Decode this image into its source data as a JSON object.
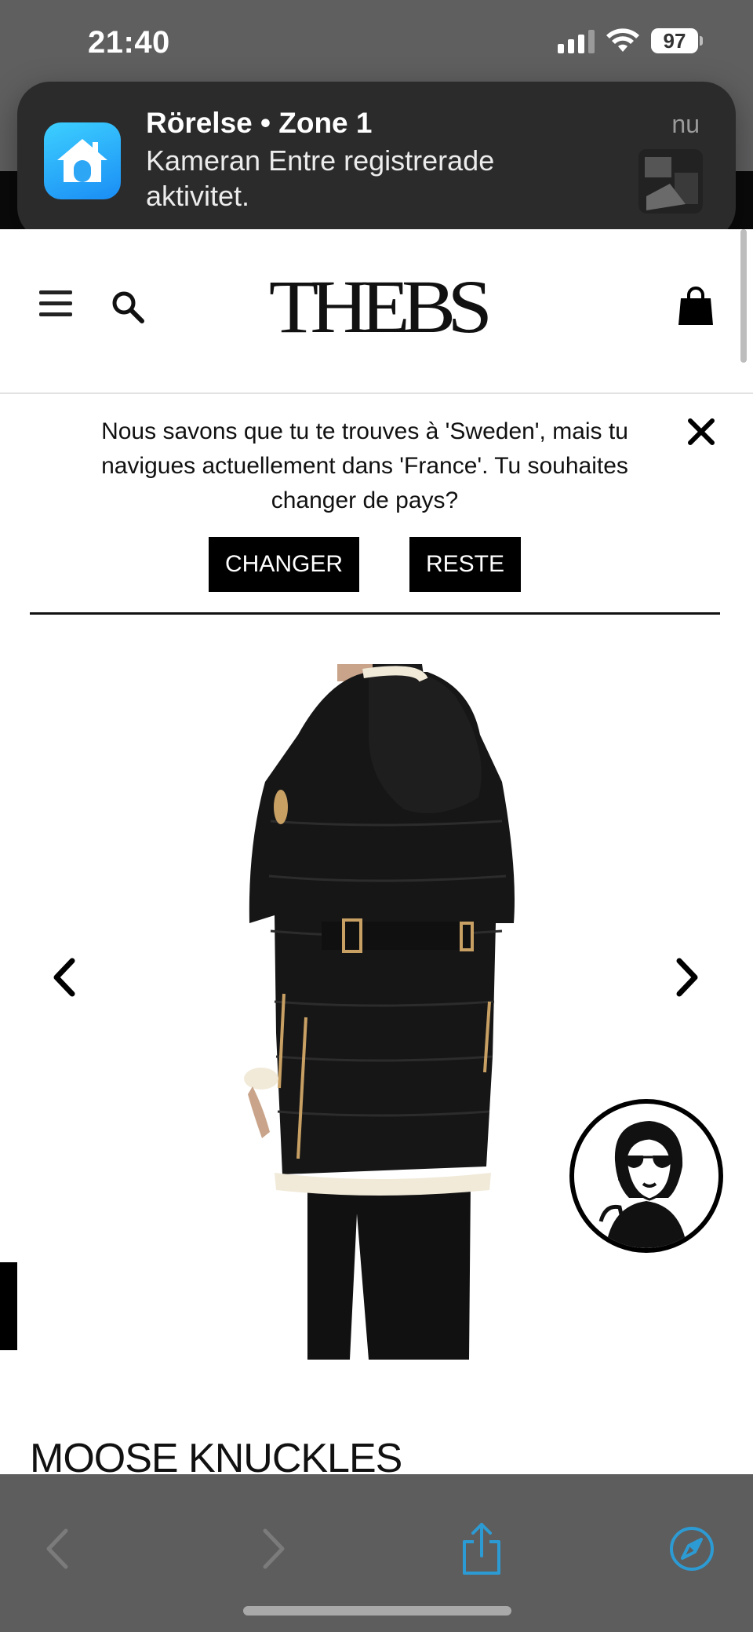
{
  "status_bar": {
    "time": "21:40",
    "battery": "97"
  },
  "notification": {
    "title": "Rörelse • Zone 1",
    "body": "Kameran Entre registrerade aktivitet.",
    "time": "nu",
    "app_icon": "home-app-icon"
  },
  "header": {
    "logo": "THEBS",
    "menu_icon": "hamburger-menu-icon",
    "search_icon": "search-icon",
    "cart_icon": "shopping-bag-icon"
  },
  "country_banner": {
    "message": "Nous savons que tu te trouves à 'Sweden', mais tu navigues actuellement dans 'France'. Tu souhaites changer de pays?",
    "change_label": "CHANGER",
    "stay_label": "RESTE"
  },
  "product": {
    "brand": "MOOSE KNUCKLES",
    "image_icon": "black-parka-photo"
  },
  "browser_toolbar": {
    "back_icon": "chevron-left-icon",
    "forward_icon": "chevron-right-icon",
    "share_icon": "share-icon",
    "safari_icon": "compass-icon"
  },
  "colors": {
    "accent": "#2d9bd3",
    "toolbar": "#5d5d5e",
    "notification": "#2b2b2c"
  }
}
